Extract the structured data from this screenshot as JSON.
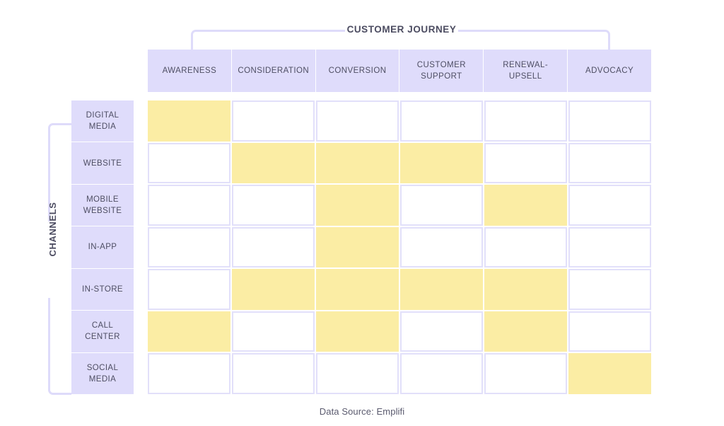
{
  "header": {
    "journey_title": "CUSTOMER JOURNEY",
    "channels_title": "CHANNELS"
  },
  "colors": {
    "header_fill": "#DFDCFB",
    "cell_border": "#E2E0FA",
    "highlight": "#FBEDA4",
    "bracket": "#DEDBFA",
    "text": "#4E4E63"
  },
  "caption": "Data Source: Emplifi",
  "chart_data": {
    "type": "heatmap",
    "title": "CUSTOMER JOURNEY",
    "xlabel": "CUSTOMER JOURNEY",
    "ylabel": "CHANNELS",
    "legend": [],
    "grid": true,
    "categories": [
      "AWARENESS",
      "CONSIDERATION",
      "CONVERSION",
      "CUSTOMER SUPPORT",
      "RENEWAL-UPSELL",
      "ADVOCACY"
    ],
    "rows": [
      "DIGITAL MEDIA",
      "WEBSITE",
      "MOBILE WEBSITE",
      "IN-APP",
      "IN-STORE",
      "CALL CENTER",
      "SOCIAL MEDIA"
    ],
    "values": [
      [
        1,
        0,
        0,
        0,
        0,
        0
      ],
      [
        0,
        1,
        1,
        1,
        0,
        0
      ],
      [
        0,
        0,
        1,
        0,
        1,
        0
      ],
      [
        0,
        0,
        1,
        0,
        0,
        0
      ],
      [
        0,
        1,
        1,
        1,
        1,
        0
      ],
      [
        1,
        0,
        1,
        0,
        1,
        0
      ],
      [
        0,
        0,
        0,
        0,
        0,
        1
      ]
    ],
    "value_legend": {
      "1": "active / highlighted",
      "0": "inactive / empty"
    }
  }
}
